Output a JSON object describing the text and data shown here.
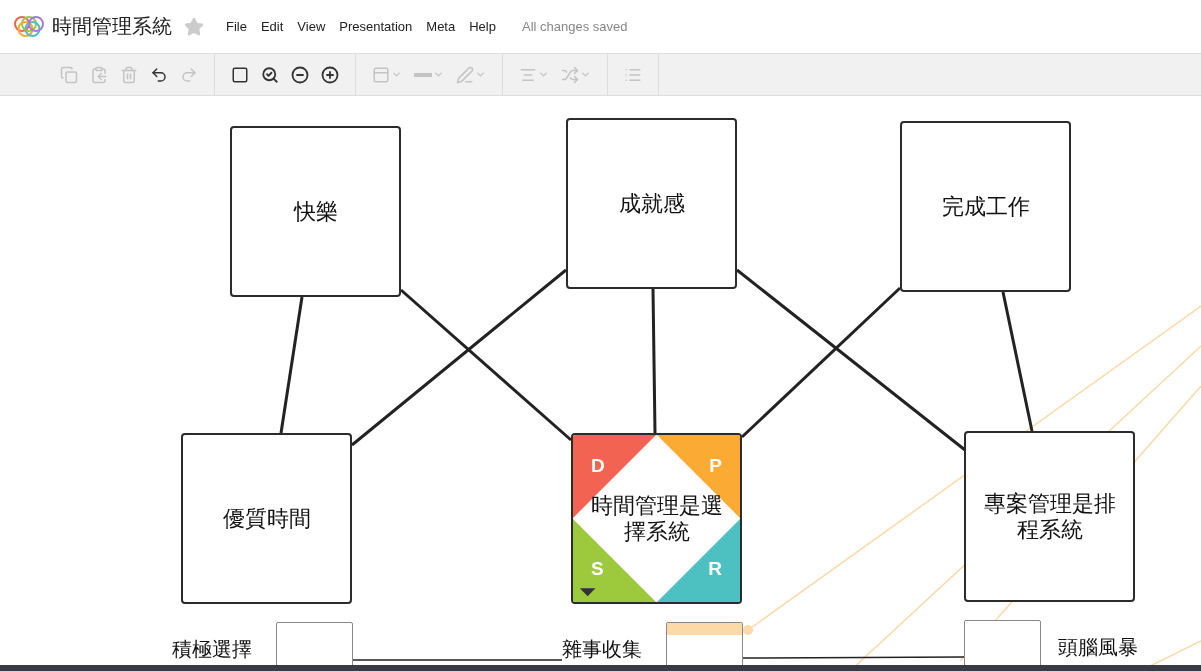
{
  "header": {
    "title": "時間管理系統",
    "starred": false,
    "menu": [
      "File",
      "Edit",
      "View",
      "Presentation",
      "Meta",
      "Help"
    ],
    "status": "All changes saved"
  },
  "toolbar": {
    "groups": [
      [
        {
          "kind": "copy",
          "disabled": true
        },
        {
          "kind": "paste",
          "disabled": true
        },
        {
          "kind": "delete",
          "disabled": true
        },
        {
          "kind": "undo",
          "disabled": false
        },
        {
          "kind": "redo",
          "disabled": true
        }
      ],
      [
        {
          "kind": "rectangle",
          "disabled": false
        },
        {
          "kind": "zoom-fit",
          "disabled": false
        },
        {
          "kind": "zoom-out",
          "disabled": false
        },
        {
          "kind": "zoom-in",
          "disabled": false
        }
      ],
      [
        {
          "kind": "fill-style",
          "disabled": true
        },
        {
          "kind": "line-width",
          "disabled": true
        },
        {
          "kind": "line-color",
          "disabled": true
        }
      ],
      [
        {
          "kind": "align",
          "disabled": true
        },
        {
          "kind": "connector",
          "disabled": true
        }
      ],
      [
        {
          "kind": "list",
          "disabled": true
        }
      ]
    ]
  },
  "nodes": [
    {
      "kind": "box",
      "label": "快樂"
    },
    {
      "kind": "box",
      "label": "成就感"
    },
    {
      "kind": "box",
      "label": "完成工作"
    },
    {
      "kind": "box",
      "label": "優質時間"
    },
    {
      "kind": "cycle",
      "label": "時間管理是選擇系統",
      "quadrants": [
        {
          "letter": "D",
          "color": "#f26451"
        },
        {
          "letter": "P",
          "color": "#fbab33"
        },
        {
          "letter": "S",
          "color": "#9dca3c"
        },
        {
          "letter": "R",
          "color": "#4dc0c2"
        }
      ]
    },
    {
      "kind": "box",
      "label": "專案管理是排程系統"
    }
  ],
  "sub_nodes": [
    {
      "label": "積極選擇",
      "highlighted": false
    },
    {
      "label": "雜事收集",
      "highlighted": true
    },
    {
      "label": "頭腦風暴",
      "highlighted": false
    }
  ]
}
